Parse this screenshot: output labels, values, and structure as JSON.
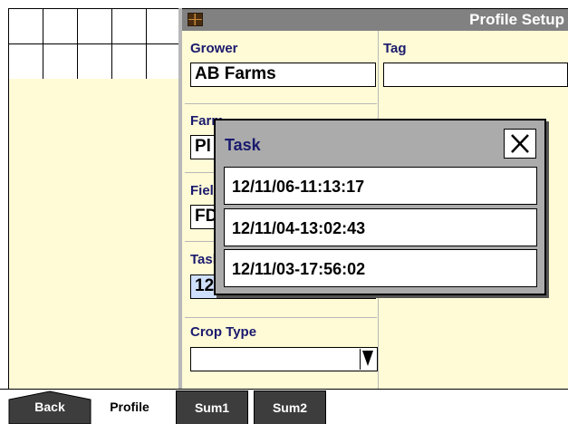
{
  "header": {
    "title": "Profile Setup"
  },
  "fields": {
    "grower": {
      "label": "Grower",
      "value": "AB Farms"
    },
    "tag": {
      "label": "Tag",
      "value": ""
    },
    "farm": {
      "label": "Farm",
      "value": "Pl"
    },
    "field": {
      "label": "Field",
      "value": "FD"
    },
    "task": {
      "label": "Task",
      "value": "12"
    },
    "crop_type": {
      "label": "Crop Type",
      "value": ""
    }
  },
  "task_popup": {
    "title": "Task",
    "items": [
      {
        "label": "12/11/06-11:13:17"
      },
      {
        "label": "12/11/04-13:02:43"
      },
      {
        "label": "12/11/03-17:56:02"
      }
    ]
  },
  "tabs": [
    {
      "label": "Back"
    },
    {
      "label": "Profile"
    },
    {
      "label": "Sum1"
    },
    {
      "label": "Sum2"
    }
  ],
  "colors": {
    "panel_bg": "#fffbd6",
    "title_bar": "#818181",
    "label_text": "#1a1a6e",
    "popup_bg": "#ababab",
    "tab_dark": "#3d3d3d",
    "task_field_bg": "#cfe0ff"
  },
  "icons": {
    "title_icon": "app-grid-icon",
    "close": "close-icon",
    "dropdown": "triangle-down-icon"
  }
}
